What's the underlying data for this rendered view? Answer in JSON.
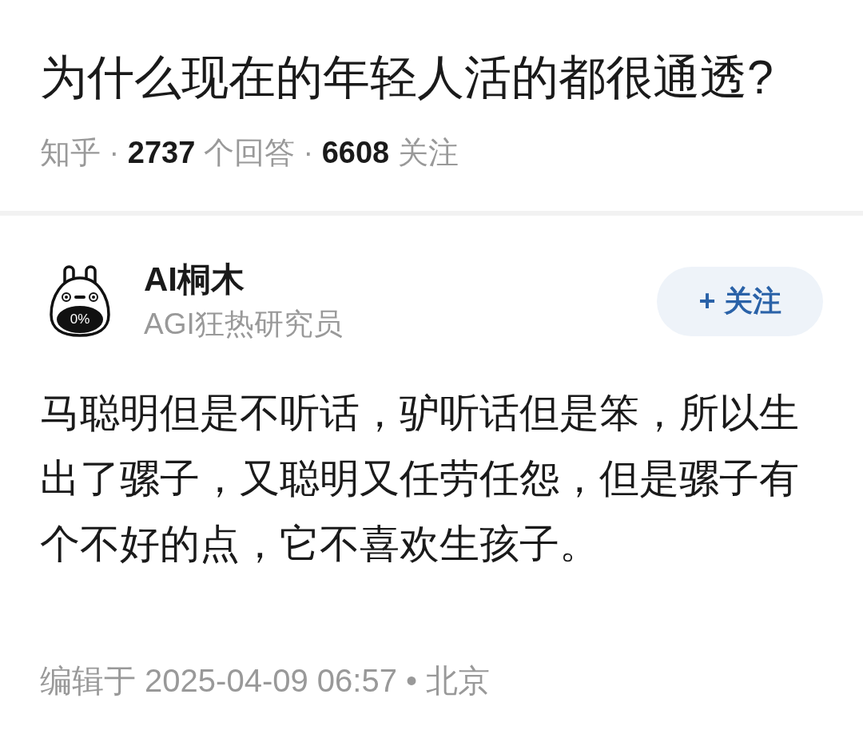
{
  "question": {
    "title": "为什么现在的年轻人活的都很通透?",
    "meta": "知乎 · **2737** 个回答 · **6608** 关注"
  },
  "answer": {
    "author": {
      "avatar_text": "0%",
      "name": "AI桐木",
      "headline": "AGI狂热研究员"
    },
    "follow_button": {
      "label": "+ 关注"
    },
    "body": "马聪明但是不听话，驴听话但是笨，所以生出了骡子，又聪明又任劳任怨，但是骡子有个不好的点，它不喜欢生孩子。",
    "footer": "编辑于 2025-04-09 06:57 • 北京"
  }
}
